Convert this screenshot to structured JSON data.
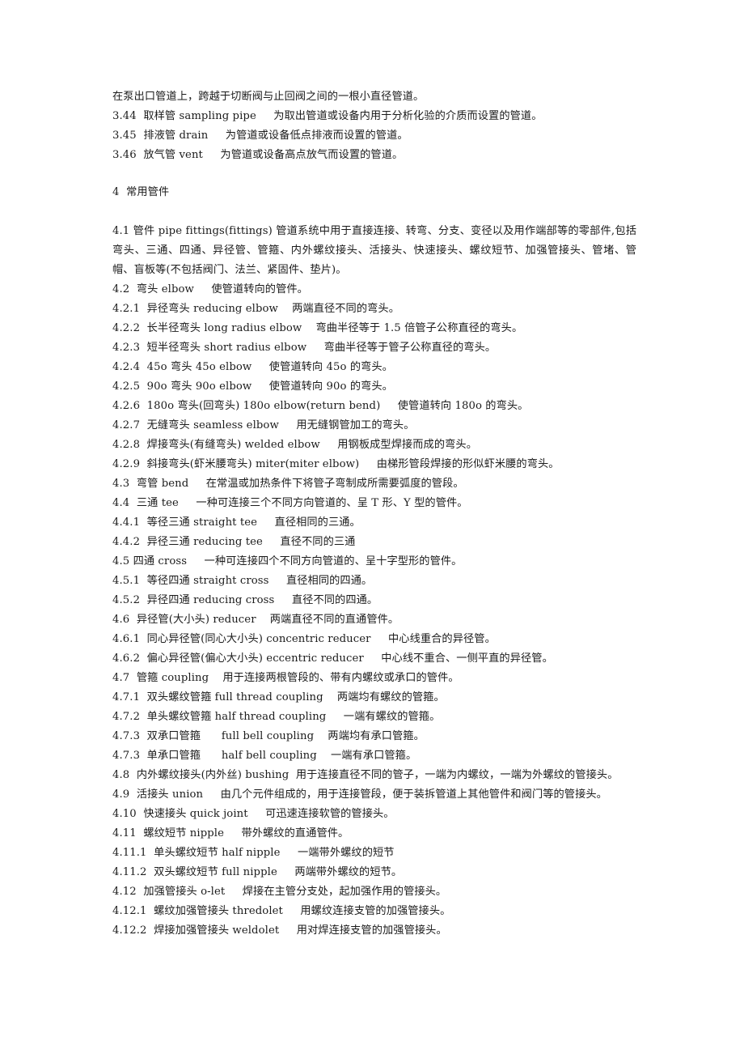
{
  "document": {
    "page_background": "#ffffff",
    "text_color": "#1b1b1b",
    "continued_paragraph": "在泵出口管道上，跨越于切断阀与止回阀之间的一根小直径管道。",
    "entries_section_3": [
      "3.44  取样管 sampling pipe     为取出管道或设备内用于分析化验的介质而设置的管道。",
      "3.45  排液管 drain     为管道或设备低点排液而设置的管道。",
      "3.46  放气管 vent     为管道或设备高点放气而设置的管道。"
    ],
    "section_4": {
      "heading": "4  常用管件",
      "entry_4_1_line1": "4.1  管件 pipe fittings(fittings)     管道系统中用于直接连接、转弯、分支、变径以及用作端部等的零部件,包括弯头、三通、四通、异径管、管箍、内外螺纹接头、活接头、快速接头、螺纹短节、加强管接头、管堵、管帽、盲板等(不包括阀门、法兰、紧固件、垫片)。",
      "entries": [
        "4.2  弯头 elbow     使管道转向的管件。",
        "4.2.1  异径弯头 reducing elbow    两端直径不同的弯头。",
        "4.2.2  长半径弯头 long radius elbow    弯曲半径等于 1.5 倍管子公称直径的弯头。",
        "4.2.3  短半径弯头 short radius elbow     弯曲半径等于管子公称直径的弯头。",
        "4.2.4  45o 弯头 45o elbow     使管道转向 45o 的弯头。",
        "4.2.5  90o 弯头 90o elbow     使管道转向 90o 的弯头。",
        "4.2.6  180o 弯头(回弯头) 180o elbow(return bend)     使管道转向 180o 的弯头。",
        "4.2.7  无缝弯头 seamless elbow     用无缝钢管加工的弯头。",
        "4.2.8  焊接弯头(有缝弯头) welded elbow     用钢板成型焊接而成的弯头。",
        "4.2.9  斜接弯头(虾米腰弯头) miter(miter elbow)     由梯形管段焊接的形似虾米腰的弯头。",
        "4.3  弯管 bend     在常温或加热条件下将管子弯制成所需要弧度的管段。",
        "4.4  三通 tee     一种可连接三个不同方向管道的、呈 T 形、Y 型的管件。",
        "4.4.1  等径三通 straight tee     直径相同的三通。",
        "4.4.2  异径三通 reducing tee     直径不同的三通",
        "4.5 四通 cross     一种可连接四个不同方向管道的、呈十字型形的管件。",
        "4.5.1  等径四通 straight cross     直径相同的四通。",
        "4.5.2  异径四通 reducing cross     直径不同的四通。",
        "4.6  异径管(大小头) reducer    两端直径不同的直通管件。",
        "4.6.1  同心异径管(同心大小头) concentric reducer     中心线重合的异径管。",
        "4.6.2  偏心异径管(偏心大小头) eccentric reducer     中心线不重合、一侧平直的异径管。",
        "4.7  管箍 coupling    用于连接两根管段的、带有内螺纹或承口的管件。",
        "4.7.1  双头螺纹管箍 full thread coupling    两端均有螺纹的管箍。",
        "4.7.2  单头螺纹管箍 half thread coupling     一端有螺纹的管箍。",
        "4.7.3  双承口管箍      full bell coupling    两端均有承口管箍。",
        "4.7.3  单承口管箍      half bell coupling    一端有承口管箍。",
        "4.8  内外螺纹接头(内外丝) bushing  用于连接直径不同的管子，一端为内螺纹，一端为外螺纹的管接头。",
        "4.9  活接头 union     由几个元件组成的，用于连接管段，便于装拆管道上其他管件和阀门等的管接头。",
        "4.10  快速接头 quick joint     可迅速连接软管的管接头。",
        "4.11  螺纹短节 nipple     带外螺纹的直通管件。",
        "4.11.1  单头螺纹短节 half nipple     一端带外螺纹的短节",
        "4.11.2  双头螺纹短节 full nipple     两端带外螺纹的短节。",
        "4.12  加强管接头 o-let     焊接在主管分支处，起加强作用的管接头。",
        "4.12.1  螺纹加强管接头 thredolet     用螺纹连接支管的加强管接头。",
        "4.12.2  焊接加强管接头 weldolet     用对焊连接支管的加强管接头。"
      ]
    }
  }
}
